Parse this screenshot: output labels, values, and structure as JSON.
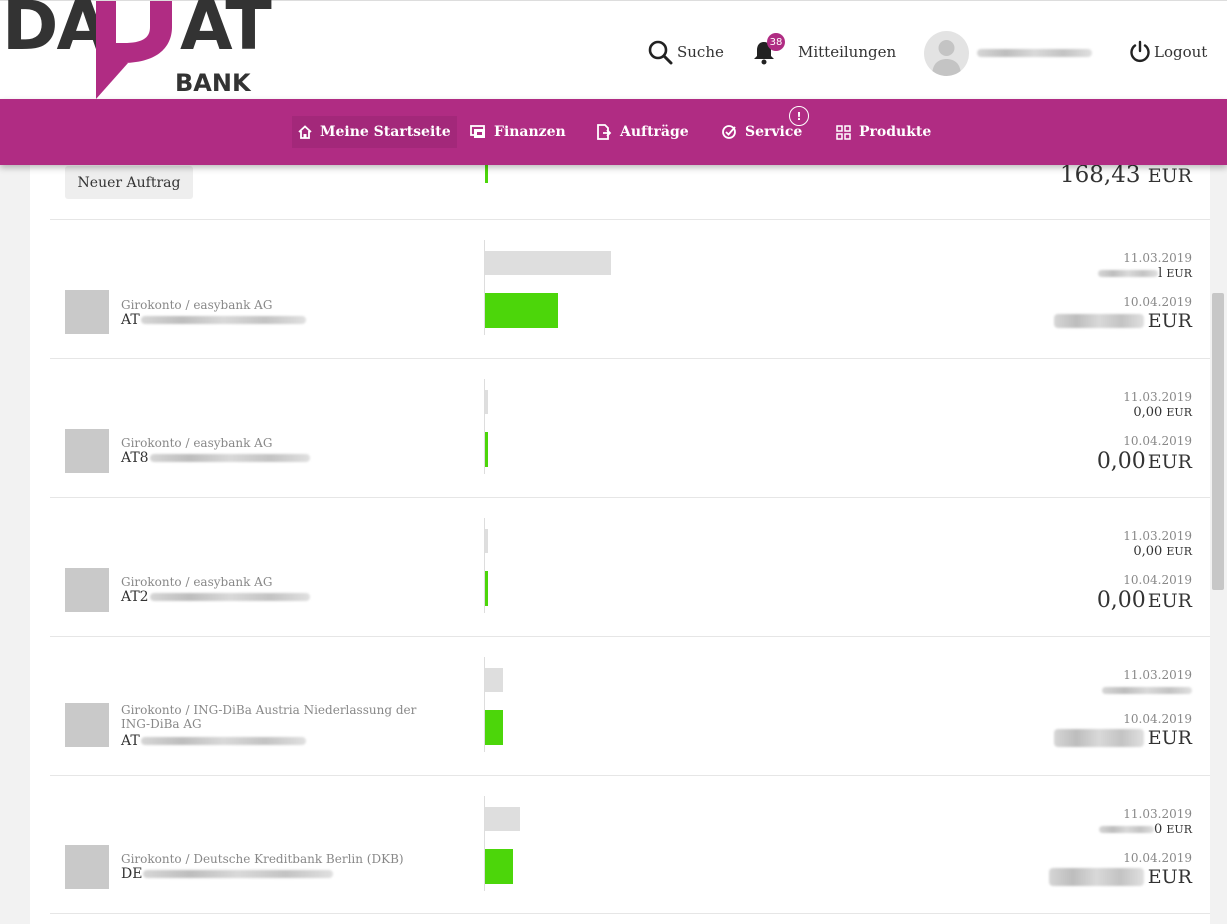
{
  "header": {
    "logo_part1": "DA",
    "logo_part2": "AT",
    "logo_sub": "BANK",
    "search_label": "Suche",
    "notifications_label": "Mitteilungen",
    "notifications_count": "38",
    "logout_label": "Logout"
  },
  "nav": {
    "items": [
      {
        "label": "Meine Startseite",
        "icon": "home-icon"
      },
      {
        "label": "Finanzen",
        "icon": "wallet-icon"
      },
      {
        "label": "Aufträge",
        "icon": "document-arrow-icon"
      },
      {
        "label": "Service",
        "icon": "check-circle-icon"
      },
      {
        "label": "Produkte",
        "icon": "grid-icon"
      }
    ],
    "service_alert": "!"
  },
  "top": {
    "new_order_label": "Neuer Auftrag",
    "balance_value": "168,43",
    "balance_currency": "EUR"
  },
  "accounts": [
    {
      "type": "Girokonto / easybank AG",
      "number_prefix": "AT",
      "date_prev": "11.03.2019",
      "amount_prev": "l",
      "date_cur": "10.04.2019",
      "amount_cur": "",
      "currency": "EUR",
      "bar_prev_ratio": 0.9,
      "bar_cur_ratio": 0.52
    },
    {
      "type": "Girokonto / easybank AG",
      "number_prefix": "AT8",
      "date_prev": "11.03.2019",
      "amount_prev": "0,00",
      "date_cur": "10.04.2019",
      "amount_cur": "0,00",
      "currency": "EUR",
      "bar_prev_ratio": 0.02,
      "bar_cur_ratio": 0.02
    },
    {
      "type": "Girokonto / easybank AG",
      "number_prefix": "AT2",
      "date_prev": "11.03.2019",
      "amount_prev": "0,00",
      "date_cur": "10.04.2019",
      "amount_cur": "0,00",
      "currency": "EUR",
      "bar_prev_ratio": 0.02,
      "bar_cur_ratio": 0.02
    },
    {
      "type": "Girokonto / ING-DiBa Austria Niederlassung der ING-DiBa AG",
      "number_prefix": "AT",
      "date_prev": "11.03.2019",
      "amount_prev": "",
      "date_cur": "10.04.2019",
      "amount_cur": "",
      "currency": "EUR",
      "bar_prev_ratio": 0.13,
      "bar_cur_ratio": 0.13
    },
    {
      "type": "Girokonto / Deutsche Kreditbank Berlin (DKB)",
      "number_prefix": "DE",
      "date_prev": "11.03.2019",
      "amount_prev": "0",
      "date_cur": "10.04.2019",
      "amount_cur": "",
      "currency": "EUR",
      "bar_prev_ratio": 0.25,
      "bar_cur_ratio": 0.2
    }
  ],
  "colors": {
    "brand": "#b02c83",
    "bar_current": "#4cd60a",
    "bar_previous": "#dedede"
  }
}
